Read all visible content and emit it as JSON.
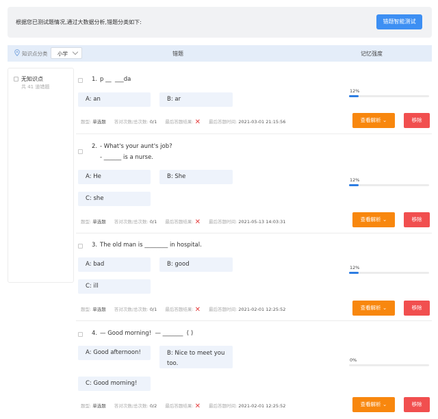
{
  "banner": {
    "text": "根据您已测试题情况,通过大数据分析,错题分类如下:",
    "test_button": "错题智能测试"
  },
  "header": {
    "knowledge_label": "知识点分类",
    "grade_value": "小学",
    "wrong_col": "错题",
    "memory_col": "记忆强度"
  },
  "sidebar": {
    "title": "无知识点",
    "count": "共 41 道错题"
  },
  "meta_labels": {
    "type": "题型:",
    "correct": "答对次数/总次数:",
    "last_result": "最后答题结果:",
    "last_time": "最后答题时间:"
  },
  "buttons": {
    "view": "查看解析",
    "remove": "移除"
  },
  "questions": [
    {
      "number": "1.",
      "text_lines": [
        "p __  ___da"
      ],
      "options": [
        "A: an",
        "B: ar"
      ],
      "type": "单选题",
      "correct_total": "0/1",
      "last_time": "2021-03-01 21:15:56",
      "memory_pct": "12%",
      "memory": 0.12
    },
    {
      "number": "2.",
      "text_lines": [
        "- What's your aunt's job?",
        "- ______ is a nurse."
      ],
      "options": [
        "A: He",
        "B: She",
        "C: she"
      ],
      "type": "单选题",
      "correct_total": "0/1",
      "last_time": "2021-05-13 14:03:31",
      "memory_pct": "12%",
      "memory": 0.12
    },
    {
      "number": "3.",
      "text_lines": [
        "The old man is ________ in hospital."
      ],
      "options": [
        "A: bad",
        "B: good",
        "C: ill"
      ],
      "type": "单选题",
      "correct_total": "0/1",
      "last_time": "2021-02-01 12:25:52",
      "memory_pct": "12%",
      "memory": 0.12
    },
    {
      "number": "4.",
      "text_lines": [
        "— Good morning!  — _______  ( )"
      ],
      "options": [
        "A: Good afternoon!",
        "B: Nice to meet you too.",
        "C: Good morning!"
      ],
      "type": "单选题",
      "correct_total": "0/2",
      "last_time": "2021-02-01 12:25:52",
      "memory_pct": "0%",
      "memory": 0.0
    }
  ],
  "colors": {
    "primary": "#3d8ff3",
    "view_button": "#f8870e",
    "remove_button": "#f14f4f",
    "progress": "#2d7de2",
    "wrong_mark": "#e43c3c"
  }
}
